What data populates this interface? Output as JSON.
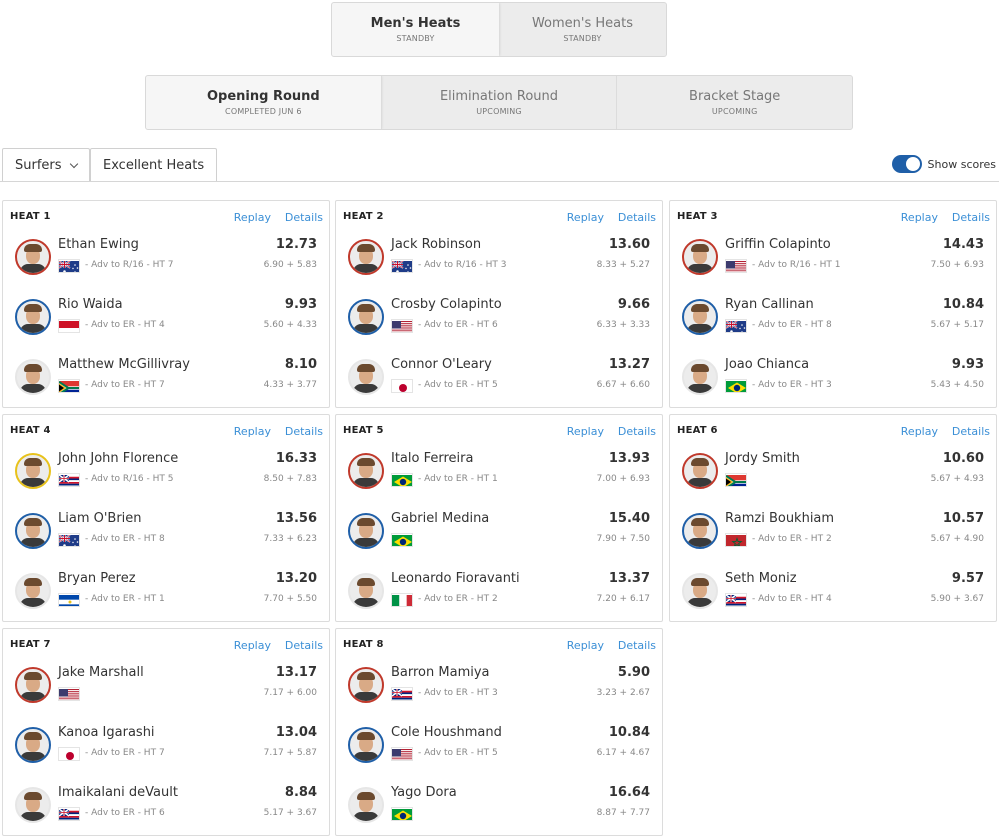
{
  "gender_tabs": [
    {
      "label": "Men's Heats",
      "status": "STANDBY",
      "active": true
    },
    {
      "label": "Women's Heats",
      "status": "STANDBY",
      "active": false
    }
  ],
  "round_tabs": [
    {
      "label": "Opening Round",
      "status": "COMPLETED JUN 6",
      "active": true
    },
    {
      "label": "Elimination Round",
      "status": "UPCOMING",
      "active": false
    },
    {
      "label": "Bracket Stage",
      "status": "UPCOMING",
      "active": false
    }
  ],
  "filters": {
    "surfers_label": "Surfers",
    "excellent_label": "Excellent Heats"
  },
  "show_scores": {
    "label": "Show scores",
    "on": true
  },
  "link_labels": {
    "replay": "Replay",
    "details": "Details"
  },
  "heats": [
    {
      "title": "HEAT 1",
      "surfers": [
        {
          "name": "Ethan Ewing",
          "score": "12.73",
          "adv": "- Adv to R/16 - HT 7",
          "waves": "6.90 + 5.83",
          "flag": "aus",
          "ring": "#c0392b"
        },
        {
          "name": "Rio Waida",
          "score": "9.93",
          "adv": "- Adv to ER - HT 4",
          "waves": "5.60 + 4.33",
          "flag": "idn",
          "ring": "#1f5fa8"
        },
        {
          "name": "Matthew McGillivray",
          "score": "8.10",
          "adv": "- Adv to ER - HT 7",
          "waves": "4.33 + 3.77",
          "flag": "rsa",
          "ring": "#e6e6e6"
        }
      ]
    },
    {
      "title": "HEAT 2",
      "surfers": [
        {
          "name": "Jack Robinson",
          "score": "13.60",
          "adv": "- Adv to R/16 - HT 3",
          "waves": "8.33 + 5.27",
          "flag": "aus",
          "ring": "#c0392b"
        },
        {
          "name": "Crosby Colapinto",
          "score": "9.66",
          "adv": "- Adv to ER - HT 6",
          "waves": "6.33 + 3.33",
          "flag": "usa",
          "ring": "#1f5fa8"
        },
        {
          "name": "Connor O'Leary",
          "score": "13.27",
          "adv": "- Adv to ER - HT 5",
          "waves": "6.67 + 6.60",
          "flag": "jpn",
          "ring": "#e6e6e6"
        }
      ]
    },
    {
      "title": "HEAT 3",
      "surfers": [
        {
          "name": "Griffin Colapinto",
          "score": "14.43",
          "adv": "- Adv to R/16 - HT 1",
          "waves": "7.50 + 6.93",
          "flag": "usa",
          "ring": "#c0392b"
        },
        {
          "name": "Ryan Callinan",
          "score": "10.84",
          "adv": "- Adv to ER - HT 8",
          "waves": "5.67 + 5.17",
          "flag": "aus",
          "ring": "#1f5fa8"
        },
        {
          "name": "Joao Chianca",
          "score": "9.93",
          "adv": "- Adv to ER - HT 3",
          "waves": "5.43 + 4.50",
          "flag": "bra",
          "ring": "#e6e6e6"
        }
      ]
    },
    {
      "title": "HEAT 4",
      "surfers": [
        {
          "name": "John John Florence",
          "score": "16.33",
          "adv": "- Adv to R/16 - HT 5",
          "waves": "8.50 + 7.83",
          "flag": "haw",
          "ring": "#e8c21b"
        },
        {
          "name": "Liam O'Brien",
          "score": "13.56",
          "adv": "- Adv to ER - HT 8",
          "waves": "7.33 + 6.23",
          "flag": "aus",
          "ring": "#1f5fa8"
        },
        {
          "name": "Bryan Perez",
          "score": "13.20",
          "adv": "- Adv to ER - HT 1",
          "waves": "7.70 + 5.50",
          "flag": "slv",
          "ring": "#e6e6e6"
        }
      ]
    },
    {
      "title": "HEAT 5",
      "surfers": [
        {
          "name": "Italo Ferreira",
          "score": "13.93",
          "adv": "- Adv to ER - HT 1",
          "waves": "7.00 + 6.93",
          "flag": "bra",
          "ring": "#c0392b"
        },
        {
          "name": "Gabriel Medina",
          "score": "15.40",
          "adv": "",
          "waves": "7.90 + 7.50",
          "flag": "bra",
          "ring": "#1f5fa8"
        },
        {
          "name": "Leonardo Fioravanti",
          "score": "13.37",
          "adv": "- Adv to ER - HT 2",
          "waves": "7.20 + 6.17",
          "flag": "ita",
          "ring": "#e6e6e6"
        }
      ]
    },
    {
      "title": "HEAT 6",
      "surfers": [
        {
          "name": "Jordy Smith",
          "score": "10.60",
          "adv": "",
          "waves": "5.67 + 4.93",
          "flag": "rsa",
          "ring": "#c0392b"
        },
        {
          "name": "Ramzi Boukhiam",
          "score": "10.57",
          "adv": "- Adv to ER - HT 2",
          "waves": "5.67 + 4.90",
          "flag": "mar",
          "ring": "#1f5fa8"
        },
        {
          "name": "Seth Moniz",
          "score": "9.57",
          "adv": "- Adv to ER - HT 4",
          "waves": "5.90 + 3.67",
          "flag": "haw",
          "ring": "#e6e6e6"
        }
      ]
    },
    {
      "title": "HEAT 7",
      "surfers": [
        {
          "name": "Jake Marshall",
          "score": "13.17",
          "adv": "",
          "waves": "7.17 + 6.00",
          "flag": "usa",
          "ring": "#c0392b"
        },
        {
          "name": "Kanoa Igarashi",
          "score": "13.04",
          "adv": "- Adv to ER - HT 7",
          "waves": "7.17 + 5.87",
          "flag": "jpn",
          "ring": "#1f5fa8"
        },
        {
          "name": "Imaikalani deVault",
          "score": "8.84",
          "adv": "- Adv to ER - HT 6",
          "waves": "5.17 + 3.67",
          "flag": "haw",
          "ring": "#e6e6e6"
        }
      ]
    },
    {
      "title": "HEAT 8",
      "surfers": [
        {
          "name": "Barron Mamiya",
          "score": "5.90",
          "adv": "- Adv to ER - HT 3",
          "waves": "3.23 + 2.67",
          "flag": "haw",
          "ring": "#c0392b"
        },
        {
          "name": "Cole Houshmand",
          "score": "10.84",
          "adv": "- Adv to ER - HT 5",
          "waves": "6.17 + 4.67",
          "flag": "usa",
          "ring": "#1f5fa8"
        },
        {
          "name": "Yago Dora",
          "score": "16.64",
          "adv": "",
          "waves": "8.87 + 7.77",
          "flag": "bra",
          "ring": "#e6e6e6"
        }
      ]
    }
  ]
}
